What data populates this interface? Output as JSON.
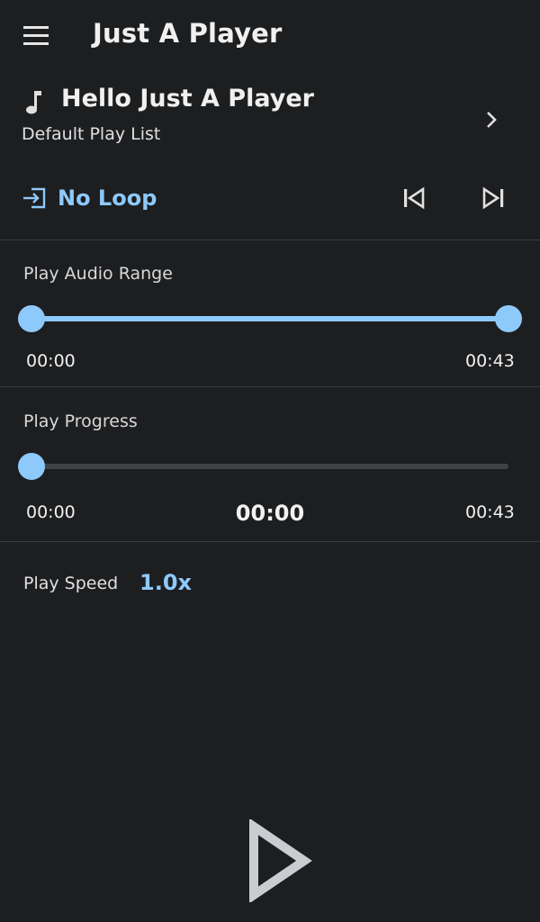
{
  "header": {
    "title": "Just A Player",
    "menu_icon": "hamburger-menu-icon"
  },
  "track": {
    "title": "Hello Just A Player",
    "playlist": "Default Play List",
    "icon": "music-note-icon"
  },
  "controls": {
    "loop_label": "No Loop",
    "loop_icon": "loop-mode-icon",
    "prev_icon": "skip-previous-icon",
    "next_icon": "skip-next-icon"
  },
  "range": {
    "label": "Play Audio Range",
    "start": "00:00",
    "end": "00:43",
    "start_fraction": 0,
    "end_fraction": 1
  },
  "progress": {
    "label": "Play Progress",
    "start": "00:00",
    "current": "00:00",
    "end": "00:43",
    "fraction": 0
  },
  "speed": {
    "label": "Play Speed",
    "value": "1.0x"
  },
  "colors": {
    "background": "#1d1e20",
    "accent": "#8ec9fb",
    "track_inactive": "#3e4146",
    "icon": "#e0e0e0",
    "play_icon": "#c9ccd0"
  }
}
